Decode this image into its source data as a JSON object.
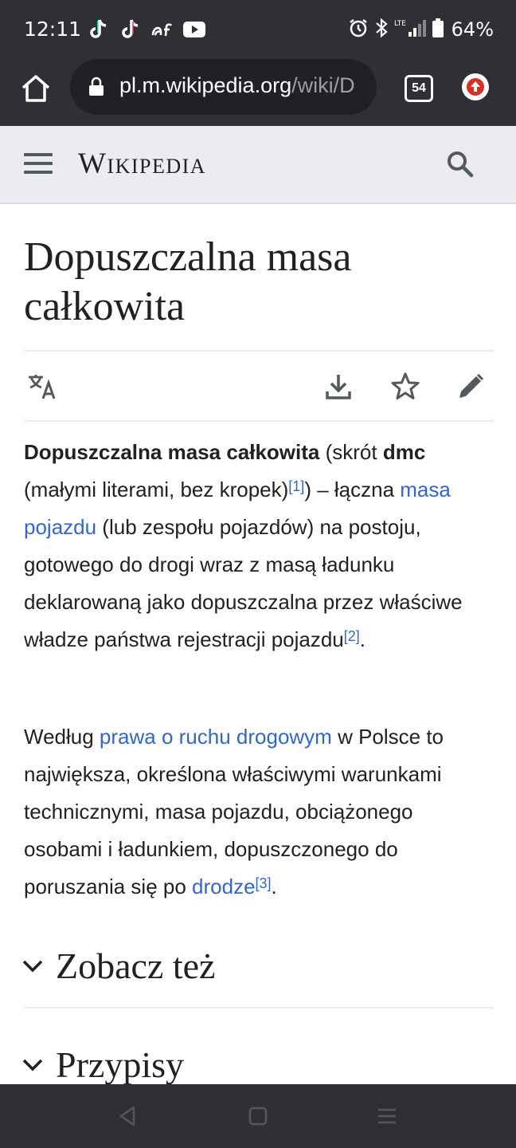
{
  "status_bar": {
    "time": "12:11",
    "battery": "64%",
    "network": "LTE",
    "notification_icons": [
      "tiktok-icon",
      "tiktok-icon",
      "af-icon",
      "youtube-icon"
    ]
  },
  "browser": {
    "url_host": "pl.m.wikipedia.org",
    "url_path": "/wiki/D",
    "tab_count": "54"
  },
  "wiki": {
    "logo_text": "Wikipedia"
  },
  "article": {
    "title": "Dopuszczalna masa całkowita",
    "p1": {
      "bold1": "Dopuszczalna masa całkowita",
      "t1": " (skrót ",
      "bold2": "dmc",
      "t2": " (małymi literami, bez kropek)",
      "ref1": "[1]",
      "t3": ") – łączna ",
      "link1": "masa pojazdu",
      "t4": " (lub zespołu pojazdów) na postoju, gotowego do drogi wraz z masą ładunku deklarowaną jako dopuszczalna przez właściwe władze państwa rejestracji pojazdu",
      "ref2": "[2]",
      "t5": "."
    },
    "p2": {
      "t1": "Według ",
      "link1": "prawa o ruchu drogowym",
      "t2": " w Polsce to największa, określona właściwymi warunkami technicznymi, masa pojazdu, obciążonego osobami i ładunkiem, dopuszczonego do poruszania się po ",
      "link2": "drodze",
      "ref3": "[3]",
      "t3": "."
    },
    "sections": [
      "Zobacz też",
      "Przypisy"
    ]
  },
  "colors": {
    "system_bar": "#2f3033",
    "wiki_header": "#eaecf0",
    "link": "#3366cc",
    "text": "#202122"
  }
}
